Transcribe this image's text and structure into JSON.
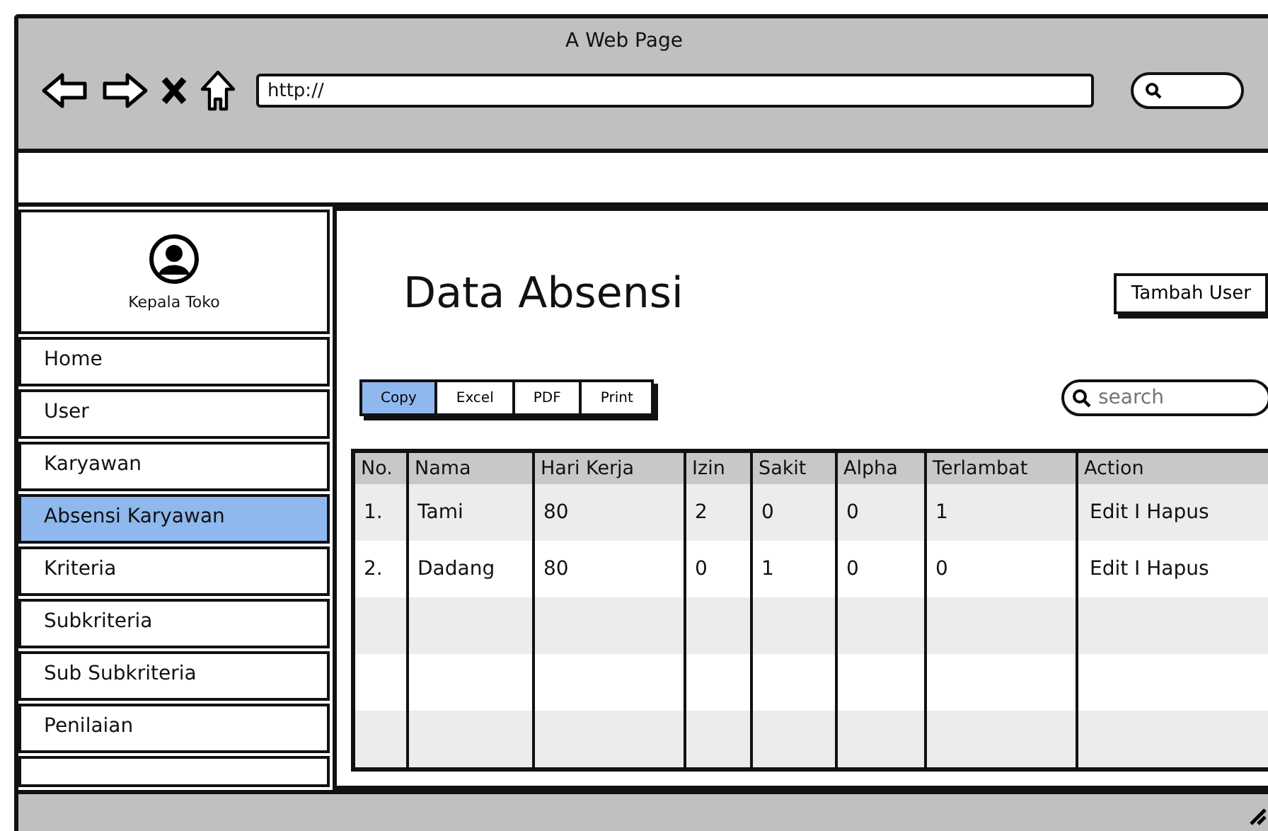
{
  "window": {
    "title": "A Web Page",
    "address": "http://"
  },
  "sidebar": {
    "profile": "Kepala Toko",
    "items": [
      {
        "label": "Home",
        "selected": false
      },
      {
        "label": "User",
        "selected": false
      },
      {
        "label": "Karyawan",
        "selected": false
      },
      {
        "label": "Absensi Karyawan",
        "selected": true
      },
      {
        "label": "Kriteria",
        "selected": false
      },
      {
        "label": "Subkriteria",
        "selected": false
      },
      {
        "label": "Sub Subkriteria",
        "selected": false
      },
      {
        "label": "Penilaian",
        "selected": false
      }
    ]
  },
  "main": {
    "title": "Data Absensi",
    "add_button": "Tambah User",
    "export_buttons": [
      {
        "label": "Copy",
        "selected": true
      },
      {
        "label": "Excel",
        "selected": false
      },
      {
        "label": "PDF",
        "selected": false
      },
      {
        "label": "Print",
        "selected": false
      }
    ],
    "search": {
      "placeholder": "search"
    },
    "table": {
      "columns": [
        "No.",
        "Nama",
        "Hari Kerja",
        "Izin",
        "Sakit",
        "Alpha",
        "Terlambat",
        "Action"
      ],
      "rows": [
        [
          "1.",
          "Tami",
          "80",
          "2",
          "0",
          "0",
          "1",
          "Edit I Hapus"
        ],
        [
          "2.",
          "Dadang",
          "80",
          "0",
          "1",
          "0",
          "0",
          "Edit I Hapus"
        ]
      ]
    }
  }
}
